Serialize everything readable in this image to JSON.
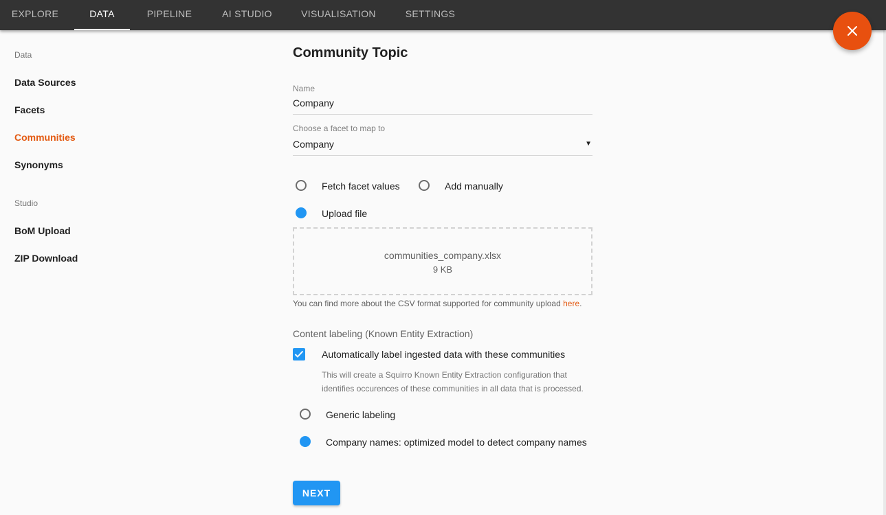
{
  "nav": {
    "tabs": [
      {
        "label": "EXPLORE"
      },
      {
        "label": "DATA"
      },
      {
        "label": "PIPELINE"
      },
      {
        "label": "AI STUDIO"
      },
      {
        "label": "VISUALISATION"
      },
      {
        "label": "SETTINGS"
      }
    ],
    "active_tab": "DATA"
  },
  "fab": {
    "icon": "close-icon",
    "color": "#e8500f"
  },
  "sidebar": {
    "sections": [
      {
        "heading": "Data",
        "items": [
          {
            "label": "Data Sources"
          },
          {
            "label": "Facets"
          },
          {
            "label": "Communities"
          },
          {
            "label": "Synonyms"
          }
        ]
      },
      {
        "heading": "Studio",
        "items": [
          {
            "label": "BoM Upload"
          },
          {
            "label": "ZIP Download"
          }
        ]
      }
    ],
    "active_item": "Communities",
    "accent_color": "#e35a12"
  },
  "form": {
    "title": "Community Topic",
    "name_field": {
      "label": "Name",
      "value": "Company"
    },
    "facet_field": {
      "label": "Choose a facet to map to",
      "value": "Company"
    },
    "source_options": [
      {
        "label": "Fetch facet values",
        "selected": false
      },
      {
        "label": "Add manually",
        "selected": false
      },
      {
        "label": "Upload file",
        "selected": true
      }
    ],
    "upload": {
      "file_name": "communities_company.xlsx",
      "file_size": "9 KB"
    },
    "hint": {
      "text": "You can find more about the CSV format supported for community upload ",
      "link_text": "here",
      "suffix": "."
    },
    "labeling": {
      "section_label": "Content labeling (Known Entity Extraction)",
      "checkbox_label": "Automatically label ingested data with these communities",
      "checked": true,
      "description_line1": "This will create a Squirro Known Entity Extraction configuration that",
      "description_line2": "identifies occurences of these communities in all data that is processed.",
      "options": [
        {
          "label": "Generic labeling",
          "selected": false
        },
        {
          "label": "Company names: optimized model to detect company names",
          "selected": true
        }
      ]
    },
    "next_label": "NEXT"
  },
  "colors": {
    "primary": "#2196f3",
    "accent": "#e35a12",
    "topbar": "#333333"
  }
}
